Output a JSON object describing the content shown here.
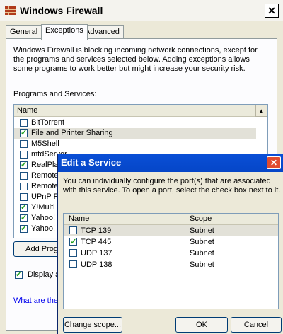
{
  "window": {
    "title": "Windows Firewall",
    "close_glyph": "✕"
  },
  "tabs": [
    {
      "label": "General"
    },
    {
      "label": "Exceptions"
    },
    {
      "label": "Advanced"
    }
  ],
  "exceptions": {
    "intro": "Windows Firewall is blocking incoming network connections, except for the programs and services selected below. Adding exceptions allows some programs to work better but might increase your security risk.",
    "section_label": "Programs and Services:",
    "column_name": "Name",
    "items": [
      {
        "label": "BitTorrent",
        "checked": false
      },
      {
        "label": "File and Printer Sharing",
        "checked": true
      },
      {
        "label": "M5Shell",
        "checked": false
      },
      {
        "label": "mtdServer",
        "checked": false
      },
      {
        "label": "RealPlay",
        "checked": true
      },
      {
        "label": "Remote A",
        "checked": false
      },
      {
        "label": "Remote",
        "checked": false
      },
      {
        "label": "UPnP Fr",
        "checked": false
      },
      {
        "label": "Y!Multi M",
        "checked": true
      },
      {
        "label": "Yahoo! F",
        "checked": true
      },
      {
        "label": "Yahoo! M",
        "checked": true
      }
    ],
    "add_program_label": "Add Progra",
    "display_label": "Display a",
    "display_checked": true,
    "help_link": "What are the"
  },
  "dialog": {
    "title": "Edit a Service",
    "close_glyph": "✕",
    "description": "You can individually configure the port(s) that are associated with this service. To open a port, select the check box next to it.",
    "columns": {
      "name": "Name",
      "scope": "Scope"
    },
    "ports": [
      {
        "name": "TCP 139",
        "scope": "Subnet",
        "checked": false
      },
      {
        "name": "TCP 445",
        "scope": "Subnet",
        "checked": true
      },
      {
        "name": "UDP 137",
        "scope": "Subnet",
        "checked": false
      },
      {
        "name": "UDP 138",
        "scope": "Subnet",
        "checked": false
      }
    ],
    "change_scope_label": "Change scope...",
    "ok_label": "OK",
    "cancel_label": "Cancel"
  }
}
